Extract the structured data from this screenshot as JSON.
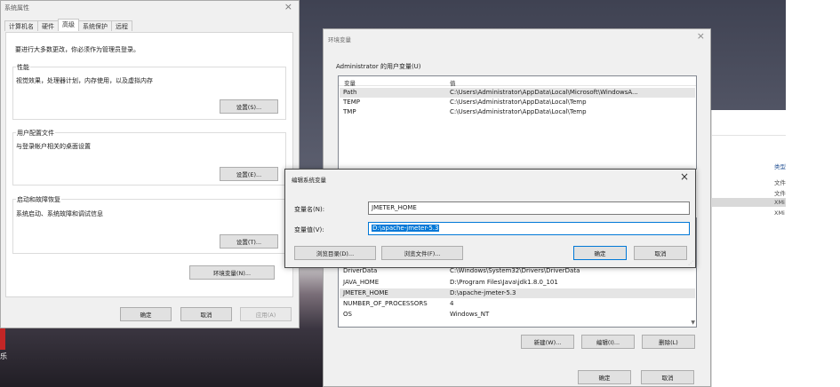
{
  "system_properties": {
    "title": "系统属性",
    "tabs": [
      "计算机名",
      "硬件",
      "高级",
      "系统保护",
      "远程"
    ],
    "admin_note": "要进行大多数更改，你必须作为管理员登录。",
    "performance": {
      "title": "性能",
      "desc": "视觉效果，处理器计划，内存使用，以及虚拟内存",
      "button": "设置(S)..."
    },
    "user_profiles": {
      "title": "用户配置文件",
      "desc": "与登录帐户相关的桌面设置",
      "button": "设置(E)..."
    },
    "startup_recovery": {
      "title": "启动和故障恢复",
      "desc": "系统启动、系统故障和调试信息",
      "button": "设置(T)..."
    },
    "env_button": "环境变量(N)...",
    "ok": "确定",
    "cancel": "取消",
    "apply": "应用(A)"
  },
  "env_vars": {
    "title": "环境变量",
    "user_section_label": "Administrator 的用户变量(U)",
    "col_var": "变量",
    "col_val": "值",
    "user_vars": [
      {
        "name": "Path",
        "value": "C:\\Users\\Administrator\\AppData\\Local\\Microsoft\\WindowsA..."
      },
      {
        "name": "TEMP",
        "value": "C:\\Users\\Administrator\\AppData\\Local\\Temp"
      },
      {
        "name": "TMP",
        "value": "C:\\Users\\Administrator\\AppData\\Local\\Temp"
      }
    ],
    "system_vars": [
      {
        "name": "DriverData",
        "value": "C:\\Windows\\System32\\Drivers\\DriverData"
      },
      {
        "name": "JAVA_HOME",
        "value": "D:\\Program Files\\Java\\jdk1.8.0_101"
      },
      {
        "name": "JMETER_HOME",
        "value": "D:\\apache-jmeter-5.3"
      },
      {
        "name": "NUMBER_OF_PROCESSORS",
        "value": "4"
      },
      {
        "name": "OS",
        "value": "Windows_NT"
      }
    ],
    "new_button": "新建(W)...",
    "edit_button": "编辑(I)...",
    "delete_button": "删除(L)",
    "ok": "确定",
    "cancel": "取消"
  },
  "edit_dialog": {
    "title": "编辑系统变量",
    "name_label": "变量名(N):",
    "value_label": "变量值(V):",
    "name_value": "JMETER_HOME",
    "value_value": "D:\\apache-jmeter-5.3",
    "browse_dir": "浏览目录(D)...",
    "browse_file": "浏览文件(F)...",
    "ok": "确定",
    "cancel": "取消"
  },
  "explorer": {
    "col_title": "类型",
    "items": [
      "文件",
      "文件",
      "XMi",
      "XMi"
    ]
  },
  "desktop_char": "乐",
  "colors": {
    "accent": "#0078d7",
    "dialog_bg": "#f0f0f0"
  }
}
